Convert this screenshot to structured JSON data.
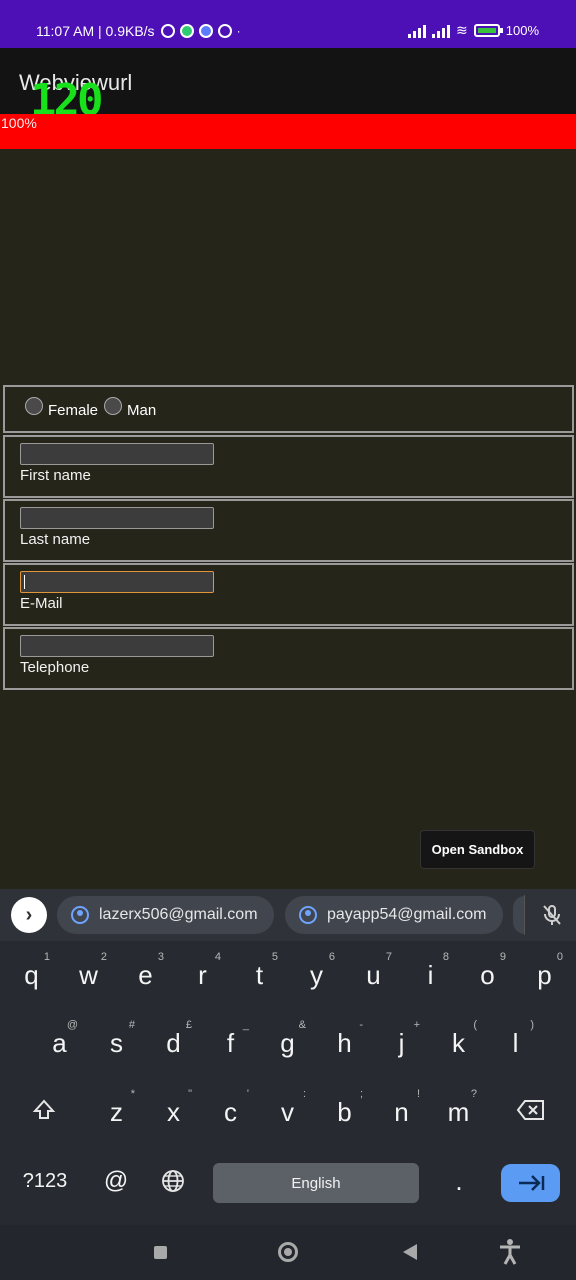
{
  "status_bar": {
    "time_speed": "11:07 AM | 0.9KB/s",
    "battery": "100%"
  },
  "app_bar": {
    "title": "Webviewurl",
    "fps_overlay": "120"
  },
  "progress": {
    "value_label": "100%",
    "value": 1.0,
    "color": "#ff0000"
  },
  "form": {
    "gender_options": [
      "Female",
      "Man"
    ],
    "fields": [
      {
        "label": "First name",
        "value": "",
        "focused": false
      },
      {
        "label": "Last name",
        "value": "",
        "focused": false
      },
      {
        "label": "E-Mail",
        "value": "",
        "focused": true
      },
      {
        "label": "Telephone",
        "value": "",
        "focused": false
      }
    ]
  },
  "sandbox_button": "Open Sandbox",
  "keyboard": {
    "suggestions": [
      "lazerx506@gmail.com",
      "payapp54@gmail.com"
    ],
    "row1": [
      {
        "k": "q",
        "h": "1"
      },
      {
        "k": "w",
        "h": "2"
      },
      {
        "k": "e",
        "h": "3"
      },
      {
        "k": "r",
        "h": "4"
      },
      {
        "k": "t",
        "h": "5"
      },
      {
        "k": "y",
        "h": "6"
      },
      {
        "k": "u",
        "h": "7"
      },
      {
        "k": "i",
        "h": "8"
      },
      {
        "k": "o",
        "h": "9"
      },
      {
        "k": "p",
        "h": "0"
      }
    ],
    "row2": [
      {
        "k": "a",
        "h": "@"
      },
      {
        "k": "s",
        "h": "#"
      },
      {
        "k": "d",
        "h": "£"
      },
      {
        "k": "f",
        "h": "_"
      },
      {
        "k": "g",
        "h": "&"
      },
      {
        "k": "h",
        "h": "-"
      },
      {
        "k": "j",
        "h": "+"
      },
      {
        "k": "k",
        "h": "("
      },
      {
        "k": "l",
        "h": ")"
      }
    ],
    "row3": [
      {
        "k": "z",
        "h": "*"
      },
      {
        "k": "x",
        "h": "\""
      },
      {
        "k": "c",
        "h": "'"
      },
      {
        "k": "v",
        "h": ":"
      },
      {
        "k": "b",
        "h": ";"
      },
      {
        "k": "n",
        "h": "!"
      },
      {
        "k": "m",
        "h": "?"
      }
    ],
    "symbols_key": "?123",
    "at_key": "@",
    "space_label": "English",
    "period_key": "."
  },
  "icons": {
    "shift": "shift-icon",
    "backspace": "backspace-icon",
    "globe": "globe-icon",
    "enter": "tab-arrow-icon",
    "mic": "mic-off-icon"
  },
  "colors": {
    "status_bar": "#4d0fb6",
    "accent_enter": "#5b9bf3",
    "fps": "#18e11b",
    "focus_border": "#e2963b"
  }
}
